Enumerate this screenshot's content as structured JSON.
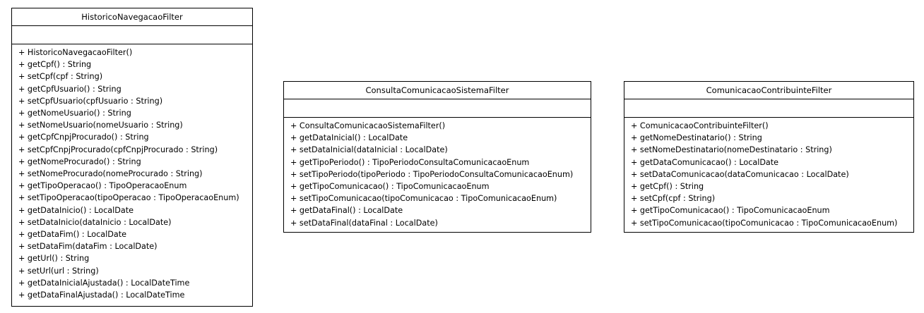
{
  "classes": [
    {
      "name": "HistoricoNavegacaoFilter",
      "attributes": [],
      "methods": [
        "+ HistoricoNavegacaoFilter()",
        "+ getCpf() : String",
        "+ setCpf(cpf : String)",
        "+ getCpfUsuario() : String",
        "+ setCpfUsuario(cpfUsuario : String)",
        "+ getNomeUsuario() : String",
        "+ setNomeUsuario(nomeUsuario : String)",
        "+ getCpfCnpjProcurado() : String",
        "+ setCpfCnpjProcurado(cpfCnpjProcurado : String)",
        "+ getNomeProcurado() : String",
        "+ setNomeProcurado(nomeProcurado : String)",
        "+ getTipoOperacao() : TipoOperacaoEnum",
        "+ setTipoOperacao(tipoOperacao : TipoOperacaoEnum)",
        "+ getDataInicio() : LocalDate",
        "+ setDataInicio(dataInicio : LocalDate)",
        "+ getDataFim() : LocalDate",
        "+ setDataFim(dataFim : LocalDate)",
        "+ getUrl() : String",
        "+ setUrl(url : String)",
        "+ getDataInicialAjustada() : LocalDateTime",
        "+ getDataFinalAjustada() : LocalDateTime"
      ]
    },
    {
      "name": "ConsultaComunicacaoSistemaFilter",
      "attributes": [],
      "methods": [
        "+ ConsultaComunicacaoSistemaFilter()",
        "+ getDataInicial() : LocalDate",
        "+ setDataInicial(dataInicial : LocalDate)",
        "+ getTipoPeriodo() : TipoPeriodoConsultaComunicacaoEnum",
        "+ setTipoPeriodo(tipoPeriodo : TipoPeriodoConsultaComunicacaoEnum)",
        "+ getTipoComunicacao() : TipoComunicacaoEnum",
        "+ setTipoComunicacao(tipoComunicacao : TipoComunicacaoEnum)",
        "+ getDataFinal() : LocalDate",
        "+ setDataFinal(dataFinal : LocalDate)"
      ]
    },
    {
      "name": "ComunicacaoContribuinteFilter",
      "attributes": [],
      "methods": [
        "+ ComunicacaoContribuinteFilter()",
        "+ getNomeDestinatario() : String",
        "+ setNomeDestinatario(nomeDestinatario : String)",
        "+ getDataComunicacao() : LocalDate",
        "+ setDataComunicacao(dataComunicacao : LocalDate)",
        "+ getCpf() : String",
        "+ setCpf(cpf : String)",
        "+ getTipoComunicacao() : TipoComunicacaoEnum",
        "+ setTipoComunicacao(tipoComunicacao : TipoComunicacaoEnum)"
      ]
    }
  ]
}
